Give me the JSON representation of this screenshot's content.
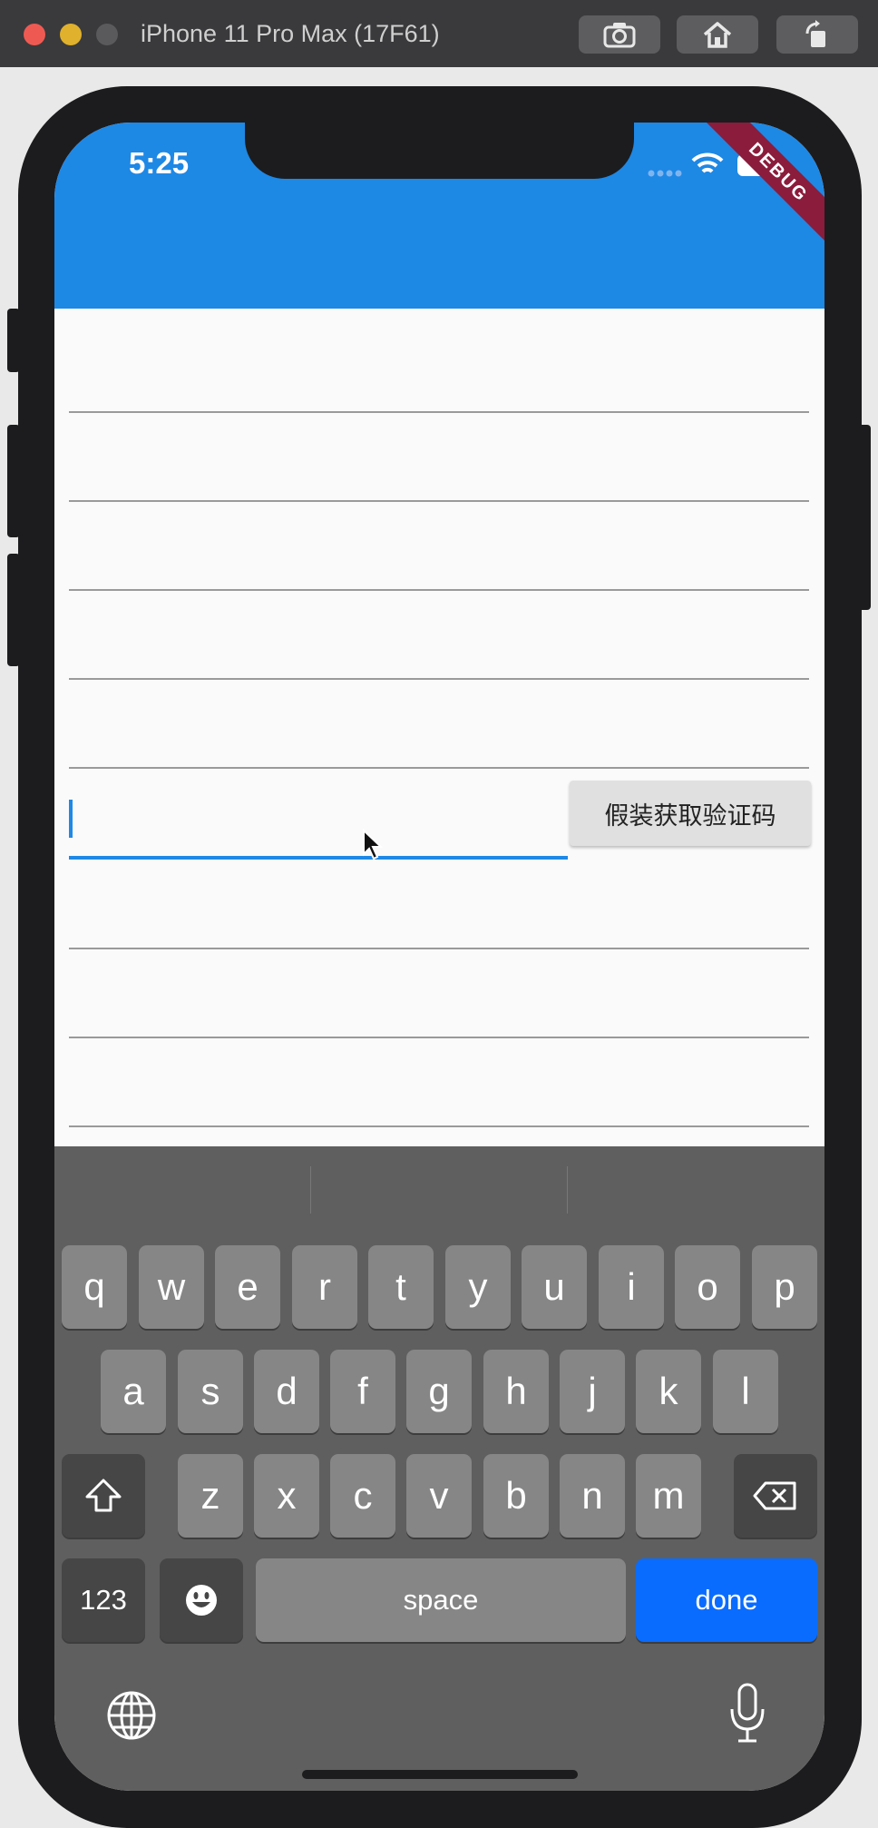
{
  "window": {
    "title": "iPhone 11 Pro Max (17F61)",
    "buttons": [
      {
        "icon": "camera-icon"
      },
      {
        "icon": "home-icon"
      },
      {
        "icon": "rotate-icon"
      }
    ]
  },
  "status_bar": {
    "time": "5:25",
    "debug_banner": "DEBUG"
  },
  "form": {
    "verify_button_label": "假装获取验证码"
  },
  "keyboard": {
    "row1": [
      "q",
      "w",
      "e",
      "r",
      "t",
      "y",
      "u",
      "i",
      "o",
      "p"
    ],
    "row2": [
      "a",
      "s",
      "d",
      "f",
      "g",
      "h",
      "j",
      "k",
      "l"
    ],
    "row3": [
      "z",
      "x",
      "c",
      "v",
      "b",
      "n",
      "m"
    ],
    "numbers_label": "123",
    "space_label": "space",
    "done_label": "done"
  },
  "colors": {
    "appbar": "#1e88e5",
    "debug": "#8b1c3b",
    "done": "#0a6cff"
  }
}
